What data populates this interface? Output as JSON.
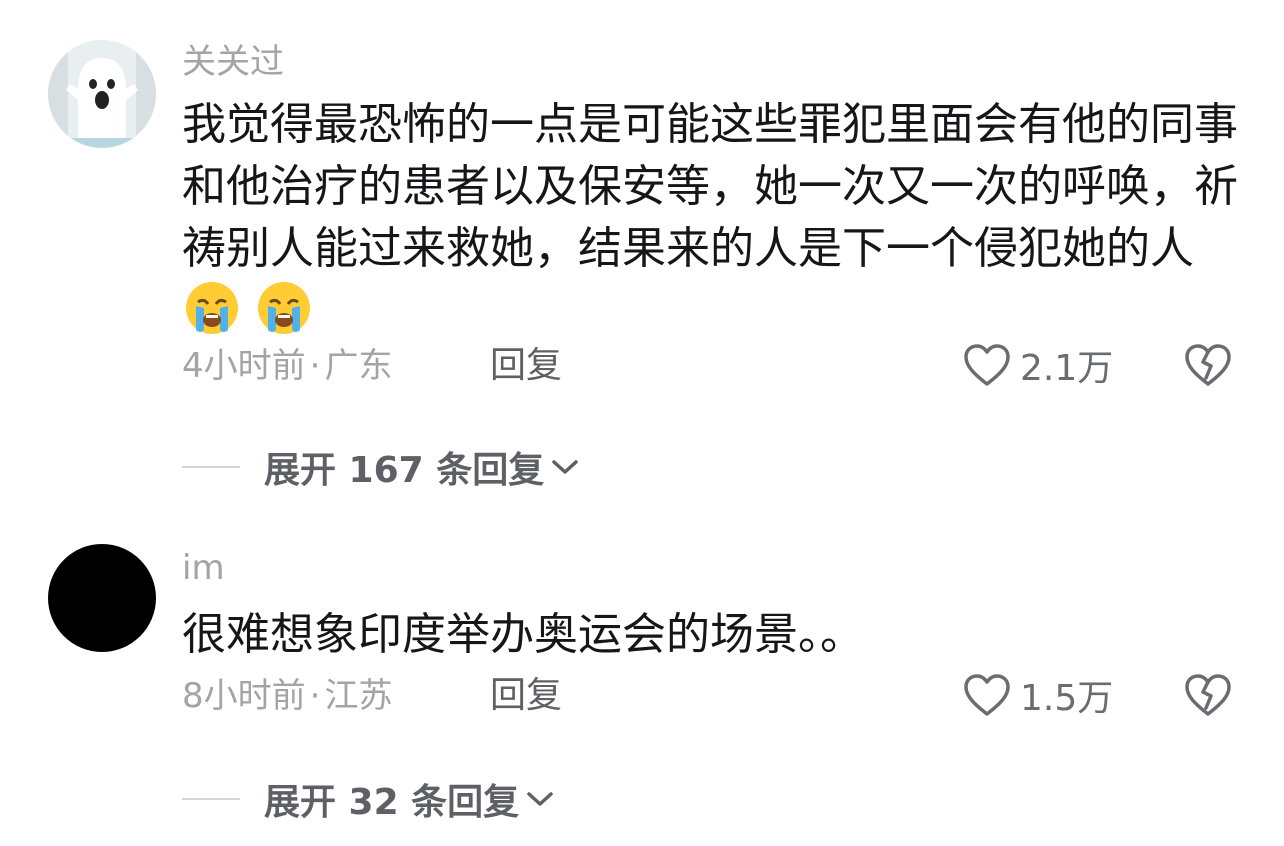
{
  "comments": [
    {
      "username": "关关过",
      "avatar": "ghost-avatar",
      "text": "我觉得最恐怖的一点是可能这些罪犯里面会有他的同事和他治疗的患者以及保安等，她一次又一次的呼唤，祈祷别人能过来救她，结果来的人是下一个侵犯她的人",
      "emojis": [
        "loudly-crying-face",
        "loudly-crying-face"
      ],
      "time": "4小时前",
      "location": "广东",
      "reply_label": "回复",
      "likes": "2.1万",
      "expand_label": "展开 167 条回复"
    },
    {
      "username": "im",
      "avatar": "black-avatar",
      "text": "很难想象印度举办奥运会的场景。。",
      "time": "8小时前",
      "location": "江苏",
      "reply_label": "回复",
      "likes": "1.5万",
      "expand_label": "展开 32 条回复"
    }
  ],
  "separator": "·",
  "icons": {
    "like": "heart-outline-icon",
    "dislike": "broken-heart-icon",
    "expand": "chevron-down-icon"
  },
  "colors": {
    "text": "#16161a",
    "muted": "#a3a3a8",
    "action": "#5f5f66"
  }
}
